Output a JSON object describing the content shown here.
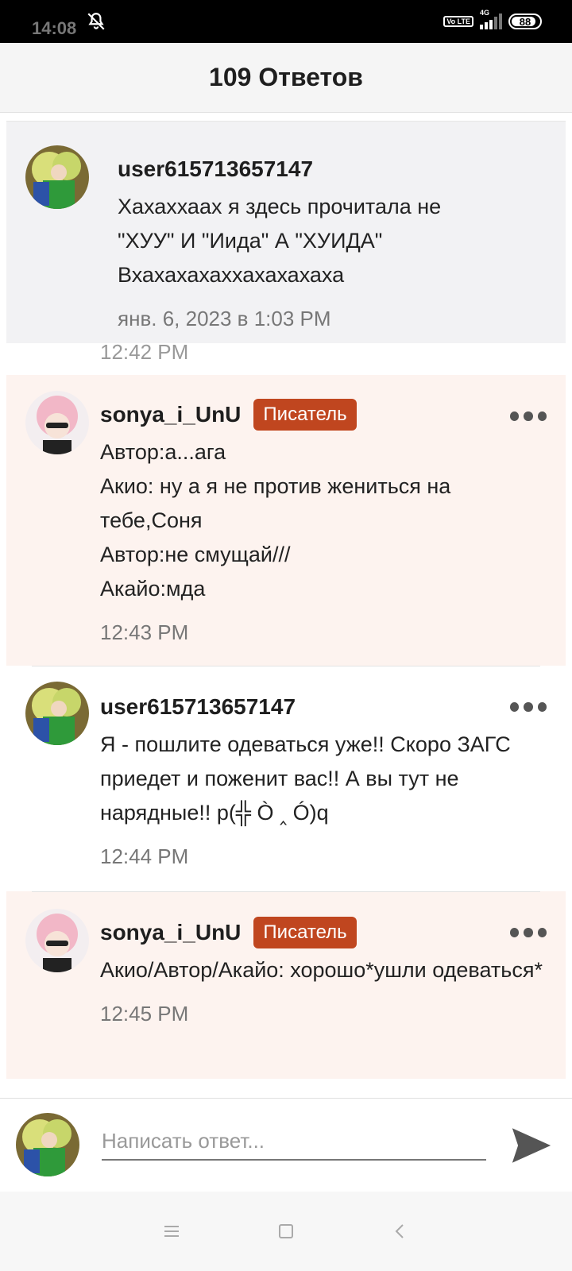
{
  "status_bar": {
    "time": "14:08",
    "network": "4G",
    "volte": "Vo LTE",
    "battery": "88"
  },
  "header": {
    "title": "109 Ответов"
  },
  "pinned_comment": {
    "username": "user615713657147",
    "text": "Хахаххаах я здесь прочитала не \"ХУУ\" И \"Иида\" А \"ХУИДА\" Вхахахахаххахахахаха",
    "timestamp": "янв. 6, 2023 в 1:03 PM",
    "ghost_time": "12:42 PM"
  },
  "comments": [
    {
      "username": "sonya_i_UnU",
      "badge": "Писатель",
      "lines": "Автор:а...ага\nАкио: ну а я не против жениться на тебе,Соня\nАвтор:не смущай///\nАкайо:мда",
      "time": "12:43 PM"
    },
    {
      "username": "user615713657147",
      "badge": "",
      "lines": "Я - пошлите одеваться уже!! Скоро ЗАГС приедет и поженит вас!! А вы тут не нарядные!! p(╬ Ò ‸ Ó)q",
      "time": "12:44 PM"
    },
    {
      "username": "sonya_i_UnU",
      "badge": "Писатель",
      "lines": "Акио/Автор/Акайо: хорошо*ушли одеваться*",
      "time": "12:45 PM"
    }
  ],
  "composer": {
    "placeholder": "Написать ответ..."
  },
  "colors": {
    "badge": "#c0461f",
    "author_bg": "#fdf3ef",
    "pinned_bg": "#f2f2f4"
  },
  "icons": [
    "notifications-off-icon",
    "more-icon",
    "send-icon",
    "menu-icon",
    "home-icon",
    "back-icon"
  ]
}
